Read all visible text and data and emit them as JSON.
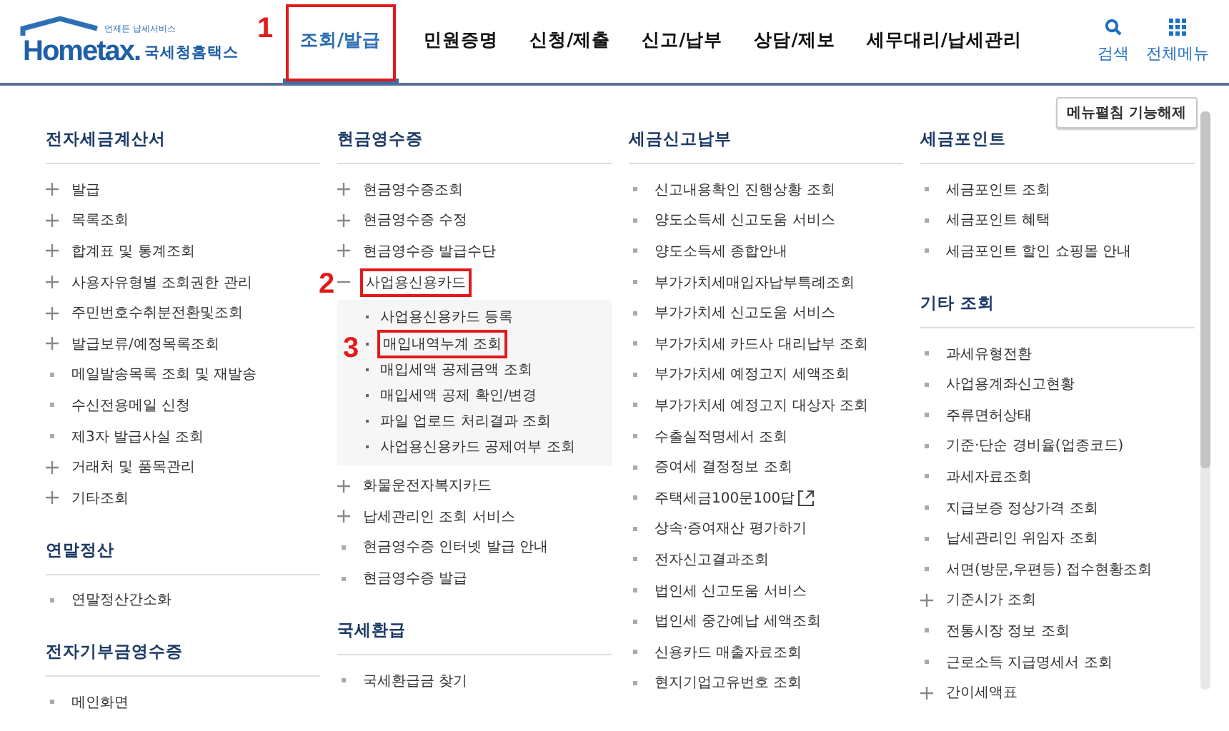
{
  "logo": {
    "tagline": "언제든 납세서비스",
    "wordmark": "Hometax.",
    "name": "국세청홈택스"
  },
  "nav": [
    {
      "label": "조회/발급",
      "selected": true,
      "callout": "1"
    },
    {
      "label": "민원증명",
      "selected": false
    },
    {
      "label": "신청/제출",
      "selected": false
    },
    {
      "label": "신고/납부",
      "selected": false
    },
    {
      "label": "상담/제보",
      "selected": false
    },
    {
      "label": "세무대리/납세관리",
      "selected": false
    }
  ],
  "utilities": [
    {
      "kind": "search",
      "label": "검색"
    },
    {
      "kind": "grid",
      "label": "전체메뉴"
    }
  ],
  "toggle_button": "메뉴펼침 기능해제",
  "columns": [
    {
      "sections": [
        {
          "title": "전자세금계산서",
          "items": [
            {
              "label": "발급",
              "kind": "plus"
            },
            {
              "label": "목록조회",
              "kind": "plus"
            },
            {
              "label": "합계표 및 통계조회",
              "kind": "plus"
            },
            {
              "label": "사용자유형별 조회권한 관리",
              "kind": "plus"
            },
            {
              "label": "주민번호수취분전환및조회",
              "kind": "plus"
            },
            {
              "label": "발급보류/예정목록조회",
              "kind": "plus"
            },
            {
              "label": "메일발송목록 조회 및 재발송",
              "kind": "bullet"
            },
            {
              "label": "수신전용메일 신청",
              "kind": "bullet"
            },
            {
              "label": "제3자 발급사실 조회",
              "kind": "bullet"
            },
            {
              "label": "거래처 및 품목관리",
              "kind": "plus"
            },
            {
              "label": "기타조회",
              "kind": "plus"
            }
          ]
        },
        {
          "title": "연말정산",
          "items": [
            {
              "label": "연말정산간소화",
              "kind": "bullet"
            }
          ]
        },
        {
          "title": "전자기부금영수증",
          "items": [
            {
              "label": "메인화면",
              "kind": "bullet"
            }
          ]
        }
      ]
    },
    {
      "sections": [
        {
          "title": "현금영수증",
          "items": [
            {
              "label": "현금영수증조회",
              "kind": "plus"
            },
            {
              "label": "현금영수증 수정",
              "kind": "plus"
            },
            {
              "label": "현금영수증 발급수단",
              "kind": "plus"
            },
            {
              "label": "사업용신용카드",
              "kind": "minus",
              "callout": "2",
              "children": [
                {
                  "label": "사업용신용카드 등록"
                },
                {
                  "label": "매입내역누계 조회",
                  "callout": "3"
                },
                {
                  "label": "매입세액 공제금액 조회"
                },
                {
                  "label": "매입세액 공제 확인/변경"
                },
                {
                  "label": "파일 업로드 처리결과 조회"
                },
                {
                  "label": "사업용신용카드 공제여부 조회"
                }
              ]
            },
            {
              "label": "화물운전자복지카드",
              "kind": "plus"
            },
            {
              "label": "납세관리인 조회 서비스",
              "kind": "plus"
            },
            {
              "label": "현금영수증 인터넷 발급 안내",
              "kind": "bullet"
            },
            {
              "label": "현금영수증 발급",
              "kind": "bullet"
            }
          ]
        },
        {
          "title": "국세환급",
          "items": [
            {
              "label": "국세환급금 찾기",
              "kind": "bullet"
            }
          ]
        }
      ]
    },
    {
      "sections": [
        {
          "title": "세금신고납부",
          "items": [
            {
              "label": "신고내용확인 진행상황 조회",
              "kind": "bullet"
            },
            {
              "label": "양도소득세 신고도움 서비스",
              "kind": "bullet"
            },
            {
              "label": "양도소득세 종합안내",
              "kind": "bullet"
            },
            {
              "label": "부가가치세매입자납부특례조회",
              "kind": "bullet"
            },
            {
              "label": "부가가치세 신고도움 서비스",
              "kind": "bullet"
            },
            {
              "label": "부가가치세 카드사 대리납부 조회",
              "kind": "bullet"
            },
            {
              "label": "부가가치세 예정고지 세액조회",
              "kind": "bullet"
            },
            {
              "label": "부가가치세 예정고지 대상자 조회",
              "kind": "bullet"
            },
            {
              "label": "수출실적명세서 조회",
              "kind": "bullet"
            },
            {
              "label": "증여세 결정정보 조회",
              "kind": "bullet"
            },
            {
              "label": "주택세금100문100답",
              "kind": "bullet",
              "external": true
            },
            {
              "label": "상속·증여재산 평가하기",
              "kind": "bullet"
            },
            {
              "label": "전자신고결과조회",
              "kind": "bullet"
            },
            {
              "label": "법인세 신고도움 서비스",
              "kind": "bullet"
            },
            {
              "label": "법인세 중간예납 세액조회",
              "kind": "bullet"
            },
            {
              "label": "신용카드 매출자료조회",
              "kind": "bullet"
            },
            {
              "label": "현지기업고유번호 조회",
              "kind": "bullet"
            }
          ]
        }
      ]
    },
    {
      "sections": [
        {
          "title": "세금포인트",
          "items": [
            {
              "label": "세금포인트 조회",
              "kind": "bullet"
            },
            {
              "label": "세금포인트 혜택",
              "kind": "bullet"
            },
            {
              "label": "세금포인트 할인 쇼핑몰 안내",
              "kind": "bullet"
            }
          ]
        },
        {
          "title": "기타 조회",
          "items": [
            {
              "label": "과세유형전환",
              "kind": "bullet"
            },
            {
              "label": "사업용계좌신고현황",
              "kind": "bullet"
            },
            {
              "label": "주류면허상태",
              "kind": "bullet"
            },
            {
              "label": "기준·단순 경비율(업종코드)",
              "kind": "bullet"
            },
            {
              "label": "과세자료조회",
              "kind": "bullet"
            },
            {
              "label": "지급보증 정상가격 조회",
              "kind": "bullet"
            },
            {
              "label": "납세관리인 위임자 조회",
              "kind": "bullet"
            },
            {
              "label": "서면(방문,우편등) 접수현황조회",
              "kind": "bullet"
            },
            {
              "label": "기준시가 조회",
              "kind": "plus"
            },
            {
              "label": "전통시장 정보 조회",
              "kind": "bullet"
            },
            {
              "label": "근로소득 지급명세서 조회",
              "kind": "bullet"
            },
            {
              "label": "간이세액표",
              "kind": "plus"
            }
          ]
        }
      ]
    }
  ]
}
